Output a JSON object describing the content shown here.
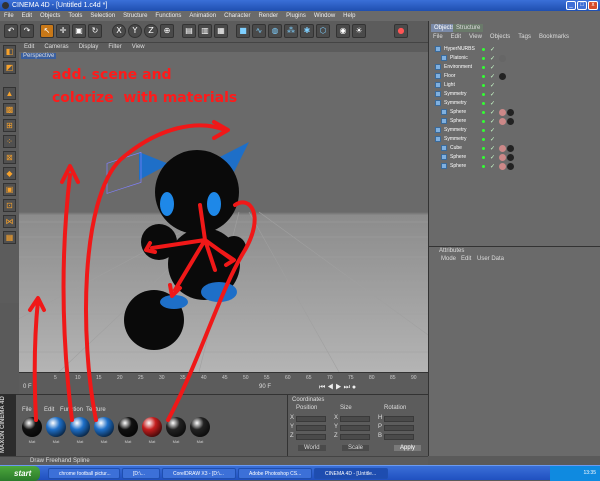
{
  "window": {
    "title": "CINEMA 4D - [Untitled 1.c4d *]",
    "min": "_",
    "max": "□",
    "close": "x"
  },
  "menu": [
    "File",
    "Edit",
    "Objects",
    "Tools",
    "Selection",
    "Structure",
    "Functions",
    "Animation",
    "Character",
    "Render",
    "Plugins",
    "Window",
    "Help"
  ],
  "toolbar": {
    "x_label": "X",
    "y_label": "Y",
    "z_label": "Z"
  },
  "viewport": {
    "menu": [
      "Edit",
      "Cameras",
      "Display",
      "Filter",
      "View"
    ],
    "label": "Perspective"
  },
  "annotation": {
    "text": "add. scene and\ncolorize  with materials",
    "color": "#ff1a1a"
  },
  "timeline": {
    "ticks": [
      "0",
      "5",
      "10",
      "15",
      "20",
      "25",
      "30",
      "35",
      "40",
      "45",
      "50",
      "55",
      "60",
      "65",
      "70",
      "75",
      "80",
      "85",
      "90"
    ],
    "current_frame": "0 F",
    "end_frame": "90 F"
  },
  "materials": {
    "menu": [
      "File",
      "Edit",
      "Function",
      "Texture"
    ],
    "items": [
      {
        "label": "Mat",
        "color": "#111111"
      },
      {
        "label": "Mat",
        "color": "#1e6fc8"
      },
      {
        "label": "Mat",
        "color": "#1e6fc8"
      },
      {
        "label": "Mat",
        "color": "#1e6fc8"
      },
      {
        "label": "Mat",
        "color": "#111111"
      },
      {
        "label": "Mat",
        "color": "#c41d1d"
      },
      {
        "label": "Mat",
        "color": "#222222"
      },
      {
        "label": "Mat",
        "color": "#222222"
      }
    ]
  },
  "coords": {
    "title": "Coordinates",
    "cols": [
      "Position",
      "Size",
      "Rotation"
    ],
    "rows": [
      "X",
      "Y",
      "Z"
    ],
    "rot_rows": [
      "H",
      "P",
      "B"
    ],
    "world": "World",
    "scale": "Scale",
    "apply": "Apply"
  },
  "maxon": "MAXON CINEMA 4D",
  "status": "Draw Freehand Spline",
  "objects": {
    "tabs": [
      "Objects",
      "Structure"
    ],
    "menu": [
      "File",
      "Edit",
      "View",
      "Objects",
      "Tags",
      "Bookmarks"
    ],
    "rows": [
      {
        "name": "HyperNURBS",
        "indent": 0,
        "mats": []
      },
      {
        "name": "Platonic",
        "indent": 1,
        "mats": [
          "#666"
        ]
      },
      {
        "name": "Environment",
        "indent": 0,
        "mats": []
      },
      {
        "name": "Floor",
        "indent": 0,
        "mats": [
          "#222"
        ]
      },
      {
        "name": "Light",
        "indent": 0,
        "mats": []
      },
      {
        "name": "Symmetry",
        "indent": 0,
        "mats": []
      },
      {
        "name": "Symmetry",
        "indent": 0,
        "mats": []
      },
      {
        "name": "Sphere",
        "indent": 1,
        "mats": [
          "#c88",
          "#222"
        ]
      },
      {
        "name": "Sphere",
        "indent": 1,
        "mats": [
          "#c88",
          "#222"
        ]
      },
      {
        "name": "Symmetry",
        "indent": 0,
        "mats": []
      },
      {
        "name": "Symmetry",
        "indent": 0,
        "mats": []
      },
      {
        "name": "Cube",
        "indent": 1,
        "mats": [
          "#c88",
          "#222"
        ]
      },
      {
        "name": "Sphere",
        "indent": 1,
        "mats": [
          "#c88",
          "#222"
        ]
      },
      {
        "name": "Sphere",
        "indent": 1,
        "mats": [
          "#c88",
          "#222"
        ]
      }
    ]
  },
  "attributes": {
    "title": "Attributes",
    "menu": [
      "Mode",
      "Edit",
      "User Data"
    ]
  },
  "taskbar": {
    "start": "start",
    "tasks": [
      "chrome football pictur...",
      "[D:\\...",
      "CorelDRAW X3 - [D:\\...",
      "Adobe Photoshop CS...",
      "CINEMA 4D - [Untitle..."
    ],
    "clock": "13:35"
  }
}
